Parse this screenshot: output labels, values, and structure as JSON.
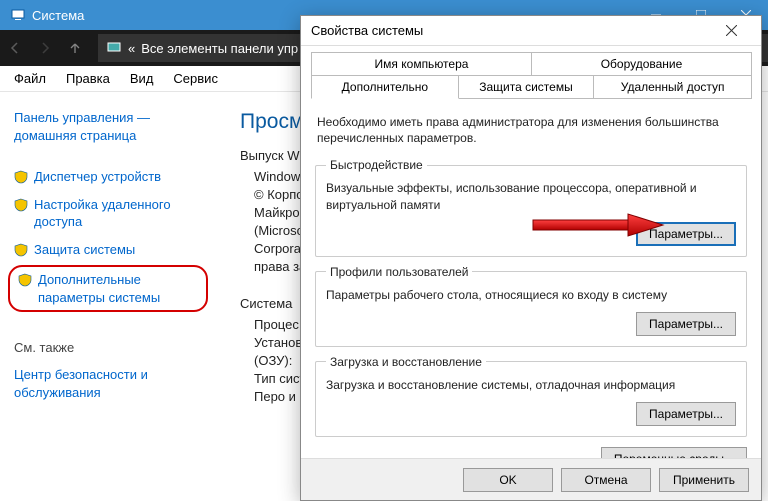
{
  "window": {
    "title": "Система",
    "address_prefix": "«",
    "address": "Все элементы панели упр"
  },
  "menu": {
    "file": "Файл",
    "edit": "Правка",
    "view": "Вид",
    "service": "Сервис"
  },
  "left": {
    "home1": "Панель управления —",
    "home2": "домашняя страница",
    "devmgr": "Диспетчер устройств",
    "remote": "Настройка удаленного доступа",
    "protection": "Защита системы",
    "advanced": "Дополнительные параметры системы",
    "seealso": "См. также",
    "security": "Центр безопасности и обслуживания"
  },
  "right": {
    "heading": "Просмо",
    "l1": "Выпуск Win",
    "l2": "Windows",
    "l3": "© Корпо",
    "l4": "Майкрос",
    "l5": "(Microso",
    "l6": "Corporat",
    "l7": "права за",
    "g_sys": "Система",
    "v1": "Процес",
    "v2": "Установ",
    "v3": "(ОЗУ):",
    "v4": "Тип сист",
    "v5": "Перо и"
  },
  "dialog": {
    "title": "Свойства системы",
    "tabs": {
      "name": "Имя компьютера",
      "hardware": "Оборудование",
      "advanced": "Дополнительно",
      "protection": "Защита системы",
      "remote": "Удаленный доступ"
    },
    "note": "Необходимо иметь права администратора для изменения большинства перечисленных параметров.",
    "perf": {
      "legend": "Быстродействие",
      "desc": "Визуальные эффекты, использование процессора, оперативной и виртуальной памяти",
      "btn": "Параметры..."
    },
    "profiles": {
      "legend": "Профили пользователей",
      "desc": "Параметры рабочего стола, относящиеся ко входу в систему",
      "btn": "Параметры..."
    },
    "startup": {
      "legend": "Загрузка и восстановление",
      "desc": "Загрузка и восстановление системы, отладочная информация",
      "btn": "Параметры..."
    },
    "envbtn": "Переменные среды...",
    "ok": "OK",
    "cancel": "Отмена",
    "apply": "Применить"
  }
}
